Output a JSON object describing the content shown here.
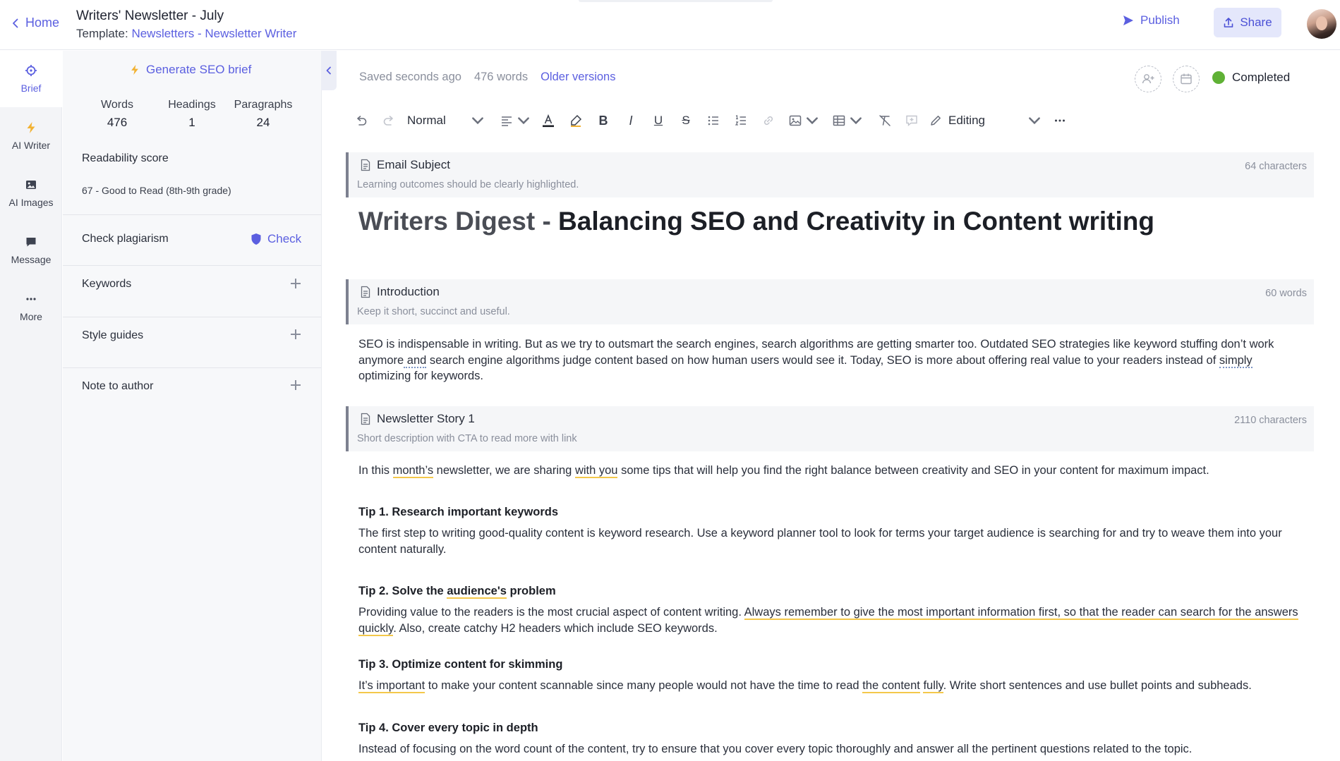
{
  "header": {
    "home_label": "Home",
    "title": "Writers' Newsletter - July",
    "template_prefix": "Template:",
    "template_name": "Newsletters - Newsletter Writer",
    "publish_label": "Publish",
    "share_label": "Share"
  },
  "rail": {
    "items": [
      {
        "label": "Brief",
        "icon": "crosshair-icon",
        "active": true
      },
      {
        "label": "AI Writer",
        "icon": "lightning-icon"
      },
      {
        "label": "AI Images",
        "icon": "image-icon"
      },
      {
        "label": "Message",
        "icon": "chat-bubble-icon"
      },
      {
        "label": "More",
        "icon": "more-dots-icon"
      }
    ]
  },
  "brief": {
    "generate_label": "Generate SEO brief",
    "stats": [
      {
        "label": "Words",
        "value": "476"
      },
      {
        "label": "Headings",
        "value": "1"
      },
      {
        "label": "Paragraphs",
        "value": "24"
      }
    ],
    "readability_title": "Readability score",
    "readability_value": "67 - Good to Read (8th-9th grade)",
    "plagiarism_label": "Check plagiarism",
    "check_label": "Check",
    "keywords_label": "Keywords",
    "style_guides_label": "Style guides",
    "note_label": "Note to author"
  },
  "editor": {
    "saved": "Saved seconds ago",
    "word_count": "476 words",
    "older_versions": "Older versions",
    "status": "Completed",
    "status_color": "#5fb135",
    "style_select": "Normal",
    "mode_select": "Editing",
    "sections": {
      "email_subject": {
        "title": "Email Subject",
        "hint": "Learning outcomes should be clearly highlighted.",
        "count": "64 characters"
      },
      "introduction": {
        "title": "Introduction",
        "hint": "Keep it short, succinct and useful.",
        "count": "60 words"
      },
      "story1": {
        "title": "Newsletter Story 1",
        "hint": "Short description with CTA to read more with link",
        "count": "2110 characters"
      }
    },
    "headline_brand": "Writers Digest - ",
    "headline_rest": "Balancing SEO and Creativity in Content writing",
    "intro": {
      "p1a": "SEO is indispensable in writing. But as we try to outsmart the search engines, search algorithms are getting smarter too. Outdated SEO strategies like keyword stuffing don’t work anymore",
      "p1b": " and",
      "p1c": " search engine algorithms judge content based on how human users would see it. Today, SEO is more about offering real value to your readers instead of ",
      "p1d": "simply",
      "p1e": " optimizing for keywords."
    },
    "story": {
      "lead_a": "In this ",
      "lead_b": "month’s",
      "lead_c": " newsletter, we are sharing ",
      "lead_d": "with you",
      "lead_e": " some tips that will help you find the right balance between creativity and SEO in your content for maximum impact.",
      "tip1_title": "Tip 1. Research important keywords",
      "tip1_body": "The first step to writing good-quality content is keyword research. Use a keyword planner tool to look for terms your target audience is searching for and try to weave them into your content naturally.",
      "tip2_title_a": "Tip 2. Solve the ",
      "tip2_title_b": "audience's",
      "tip2_title_c": " problem",
      "tip2_body_a": "Providing value to the readers is the most crucial aspect of content writing. ",
      "tip2_body_b": "Always remember to give the most important information first, so that the reader can search for the answers quickly",
      "tip2_body_c": ". Also, create catchy H2 headers which include SEO keywords.",
      "tip3_title": "Tip 3. Optimize content for skimming",
      "tip3_body_a": "It’s important",
      "tip3_body_b": " to make your content scannable since many people would not have the time to read ",
      "tip3_body_c": "the content",
      "tip3_body_d": " ",
      "tip3_body_e": "fully",
      "tip3_body_f": ". Write short sentences and use bullet points and subheads.",
      "tip4_title": "Tip 4. Cover every topic in depth",
      "tip4_body": "Instead of focusing on the word count of the content, try to ensure that you cover every topic thoroughly and answer all the pertinent questions related to the topic."
    }
  },
  "colors": {
    "accent": "#5b5fe0",
    "highlight": "#f4c84a"
  }
}
